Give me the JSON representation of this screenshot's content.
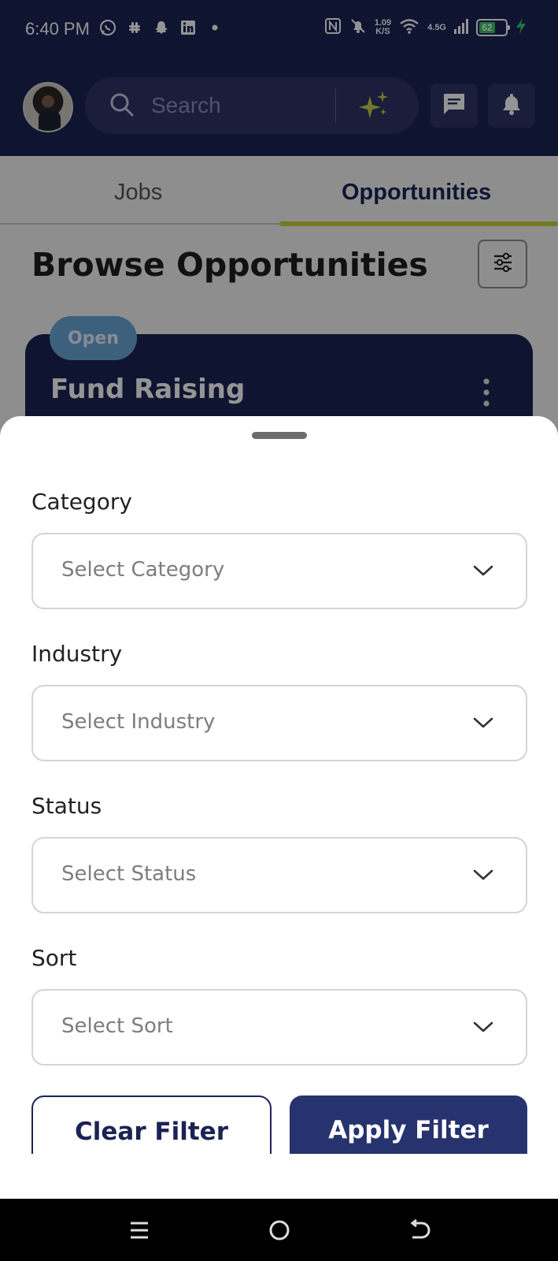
{
  "status_bar": {
    "time": "6:40 PM",
    "net_speed_top": "1.09",
    "net_speed_bottom": "K/S",
    "network": "4.5G",
    "battery": "62"
  },
  "header": {
    "search_placeholder": "Search",
    "accent_color": "#c9cf4b",
    "brand_color": "#1b2354"
  },
  "tabs": [
    {
      "label": "Jobs",
      "active": false
    },
    {
      "label": "Opportunities",
      "active": true
    }
  ],
  "page": {
    "title": "Browse Opportunities"
  },
  "card": {
    "status_badge": "Open",
    "title": "Fund Raising"
  },
  "filter_sheet": {
    "fields": [
      {
        "label": "Category",
        "placeholder": "Select Category"
      },
      {
        "label": "Industry",
        "placeholder": "Select Industry"
      },
      {
        "label": "Status",
        "placeholder": "Select Status"
      },
      {
        "label": "Sort",
        "placeholder": "Select Sort"
      }
    ],
    "clear_label": "Clear Filter",
    "apply_label": "Apply Filter"
  },
  "icons": [
    "whatsapp-icon",
    "slack-icon",
    "snapchat-icon",
    "linkedin-icon",
    "nfc-icon",
    "mute-icon",
    "wifi-icon",
    "signal-icon",
    "battery-icon",
    "search-icon",
    "sparkle-icon",
    "chat-icon",
    "bell-icon",
    "filter-icon",
    "more-vert-icon",
    "chevron-down-icon",
    "recents-icon",
    "home-icon",
    "back-icon"
  ]
}
